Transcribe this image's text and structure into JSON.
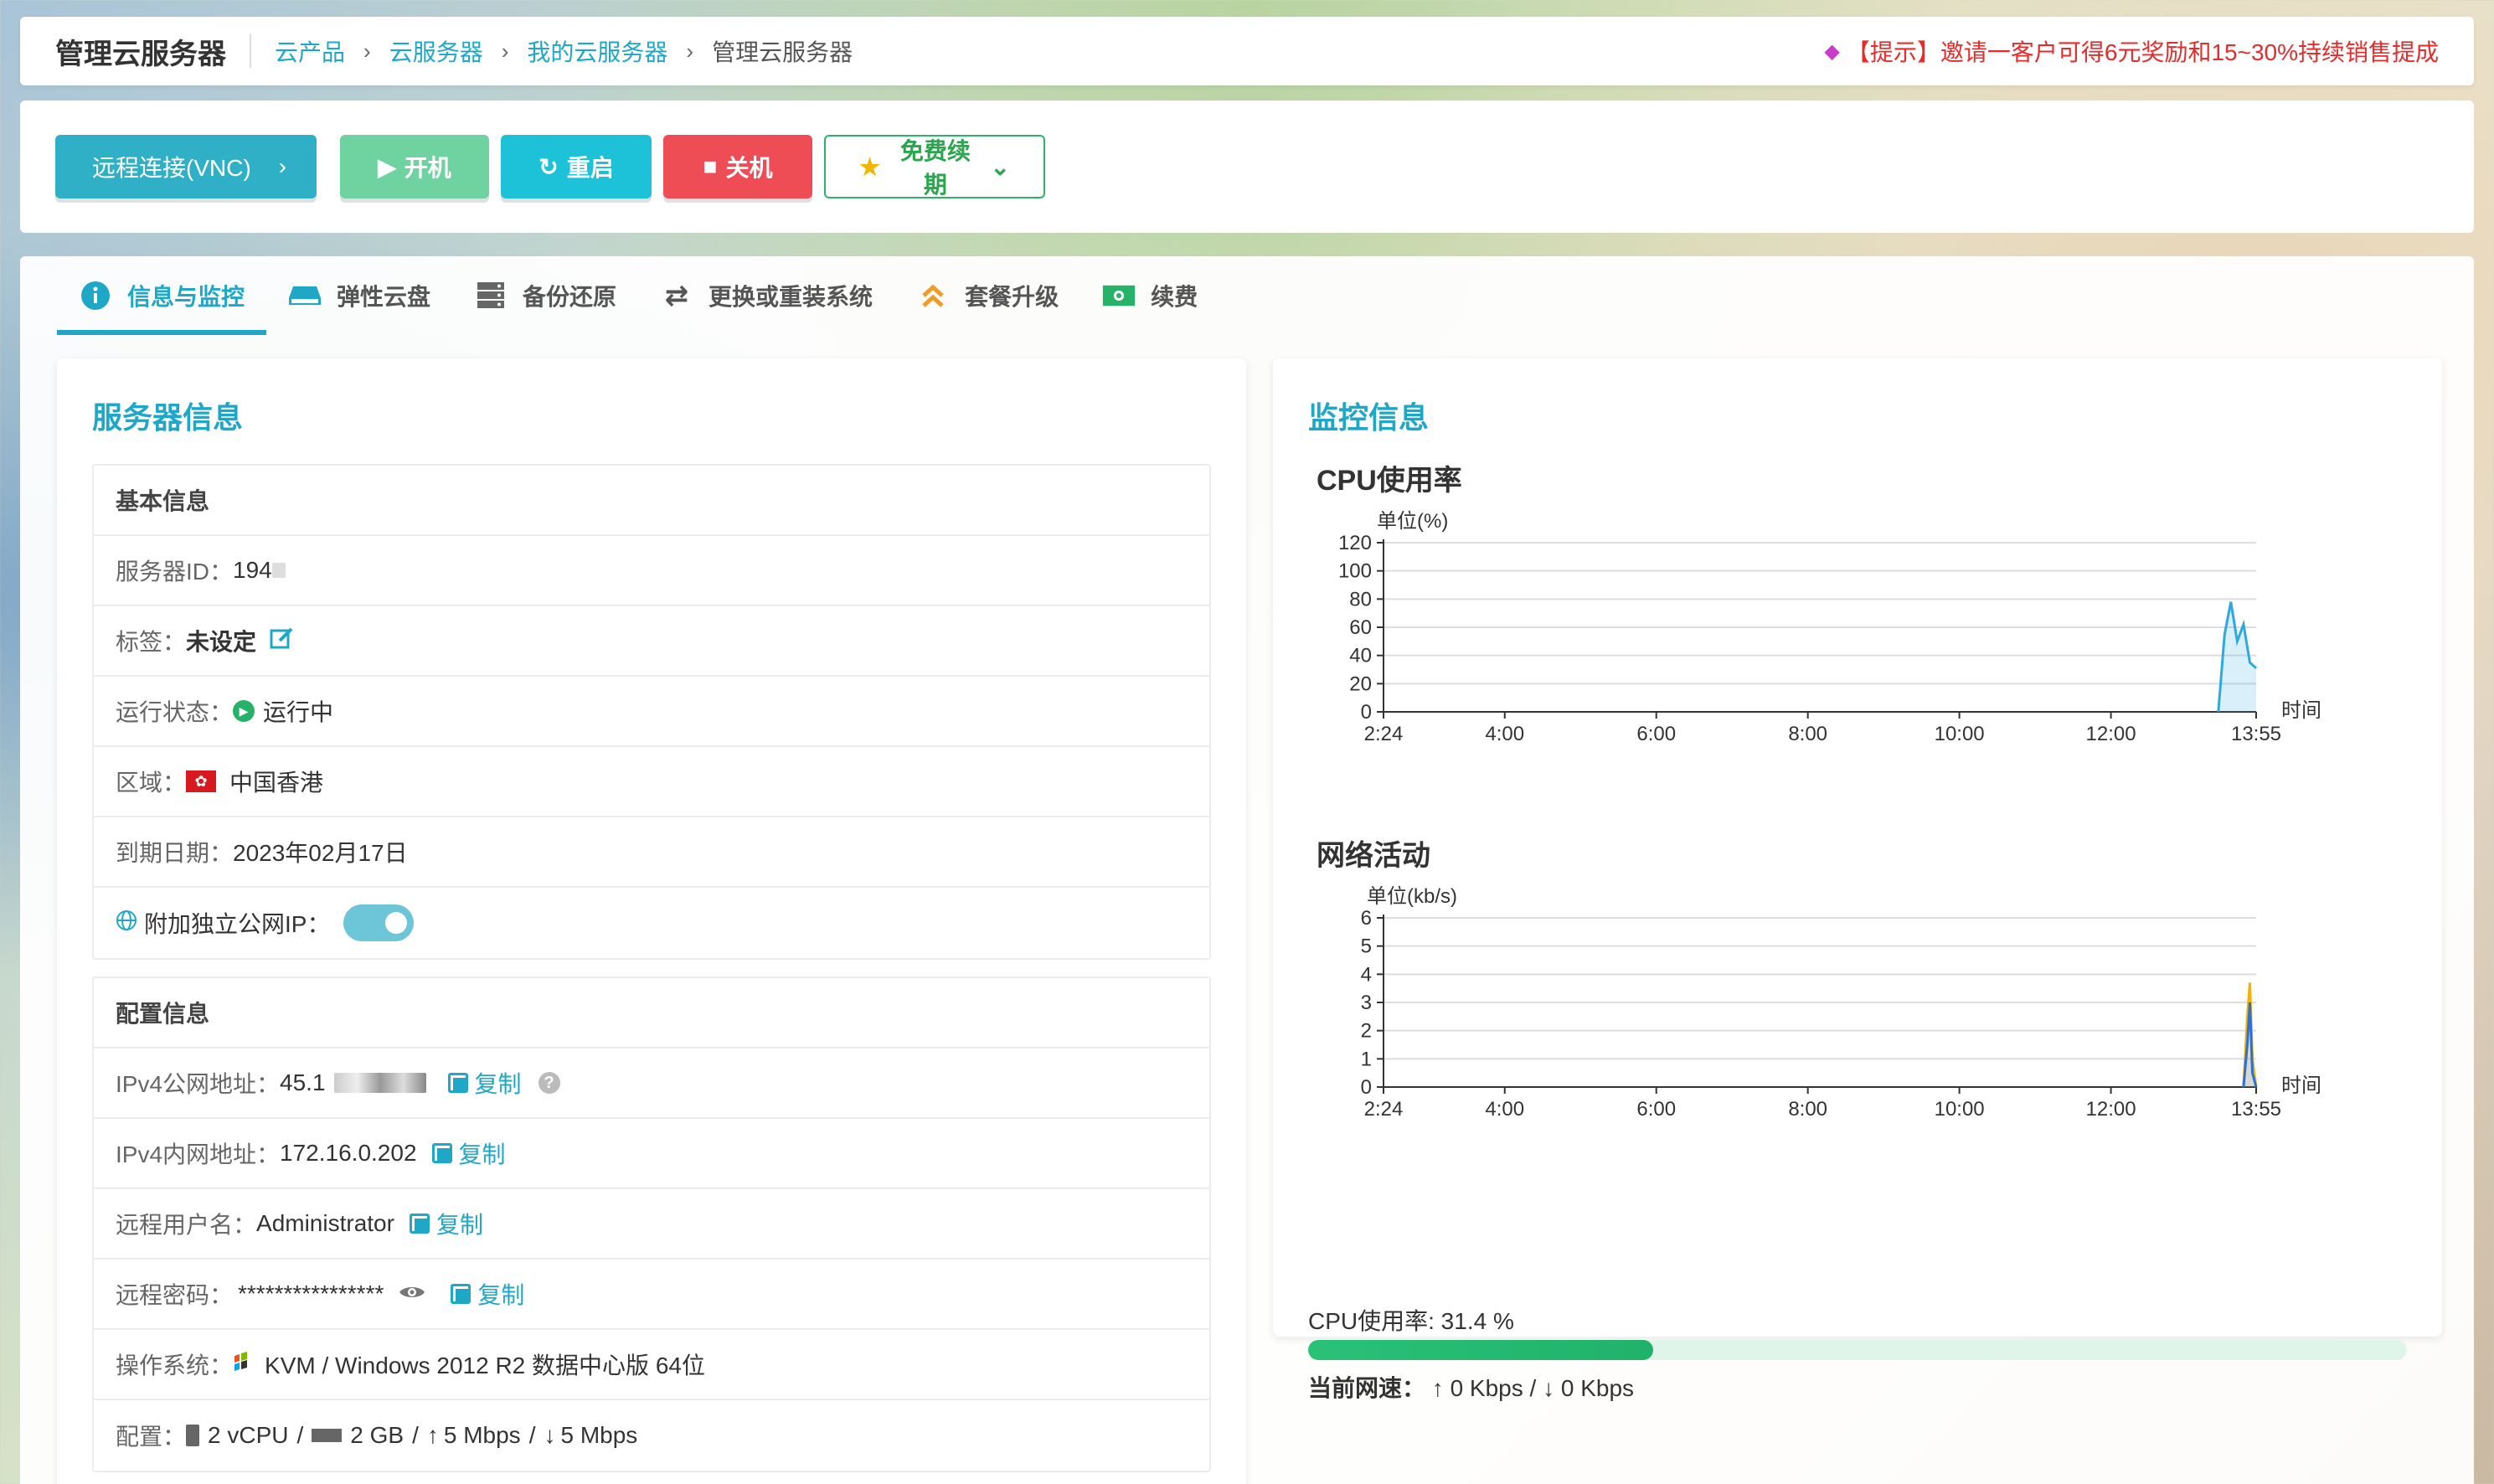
{
  "topbar": {
    "title": "管理云服务器",
    "breadcrumbs": [
      "云产品",
      "云服务器",
      "我的云服务器"
    ],
    "current": "管理云服务器",
    "notice": "【提示】邀请一客户可得6元奖励和15~30%持续销售提成"
  },
  "actions": {
    "vnc": "远程连接(VNC)",
    "start": "开机",
    "restart": "重启",
    "shutdown": "关机",
    "renew": "免费续期"
  },
  "tabs": [
    {
      "label": "信息与监控",
      "icon": "info-icon"
    },
    {
      "label": "弹性云盘",
      "icon": "disk-icon"
    },
    {
      "label": "备份还原",
      "icon": "server-icon"
    },
    {
      "label": "更换或重装系统",
      "icon": "swap-icon"
    },
    {
      "label": "套餐升级",
      "icon": "upgrade-icon"
    },
    {
      "label": "续费",
      "icon": "money-icon"
    }
  ],
  "server_info": {
    "title": "服务器信息",
    "basic": {
      "header": "基本信息",
      "id_label": "服务器ID：",
      "id_value": "194",
      "tag_label": "标签：",
      "tag_value": "未设定",
      "status_label": "运行状态：",
      "status_value": "运行中",
      "region_label": "区域：",
      "region_value": "中国香港",
      "expire_label": "到期日期：",
      "expire_value": "2023年02月17日",
      "public_ip_label": "附加独立公网IP："
    },
    "config": {
      "header": "配置信息",
      "ipv4_public_label": "IPv4公网地址：",
      "ipv4_public_value": "45.1",
      "ipv4_private_label": "IPv4内网地址：",
      "ipv4_private_value": "172.16.0.202",
      "user_label": "远程用户名：",
      "user_value": "Administrator",
      "password_label": "远程密码：",
      "password_value": "****************",
      "os_label": "操作系统：",
      "os_value": "KVM / Windows 2012 R2 数据中心版 64位",
      "spec_label": "配置：",
      "spec_vcpu": "2 vCPU",
      "spec_ram": "2 GB",
      "spec_up": "5 Mbps",
      "spec_down": "5 Mbps",
      "copy": "复制"
    }
  },
  "monitor": {
    "title": "监控信息",
    "cpu_label": "CPU使用率: 31.4 %",
    "cpu_percent": 31.4,
    "speed_label": "当前网速：",
    "speed_up": "0 Kbps",
    "speed_down": "0 Kbps"
  },
  "chart_data": [
    {
      "type": "area",
      "title": "CPU使用率",
      "ylabel": "单位(%)",
      "xlabel": "时间",
      "ylim": [
        0,
        120
      ],
      "yticks": [
        0,
        20,
        40,
        60,
        80,
        100,
        120
      ],
      "xtick_labels": [
        "2:24\n1/17",
        "4:00",
        "6:00",
        "8:00",
        "10:00",
        "12:00",
        "13:55"
      ],
      "x": [
        "13:25",
        "13:30",
        "13:35",
        "13:40",
        "13:45",
        "13:50",
        "13:55"
      ],
      "series": [
        {
          "values": [
            0,
            55,
            78,
            50,
            62,
            35,
            31
          ],
          "color": "#2ea8e0"
        }
      ]
    },
    {
      "type": "area",
      "title": "网络活动",
      "ylabel": "单位(kb/s)",
      "xlabel": "时间",
      "ylim": [
        0,
        6
      ],
      "yticks": [
        0,
        1,
        2,
        3,
        4,
        5,
        6
      ],
      "xtick_labels": [
        "2:24\n1/17",
        "4:00",
        "6:00",
        "8:00",
        "10:00",
        "12:00",
        "13:55"
      ],
      "x": [
        "13:45",
        "13:48",
        "13:50",
        "13:52",
        "13:55"
      ],
      "series": [
        {
          "values": [
            0,
            2.5,
            3.7,
            1.0,
            0
          ],
          "color": "#f0b400"
        },
        {
          "values": [
            0,
            1.5,
            3.0,
            0.5,
            0
          ],
          "color": "#2f6fd4"
        }
      ]
    }
  ]
}
